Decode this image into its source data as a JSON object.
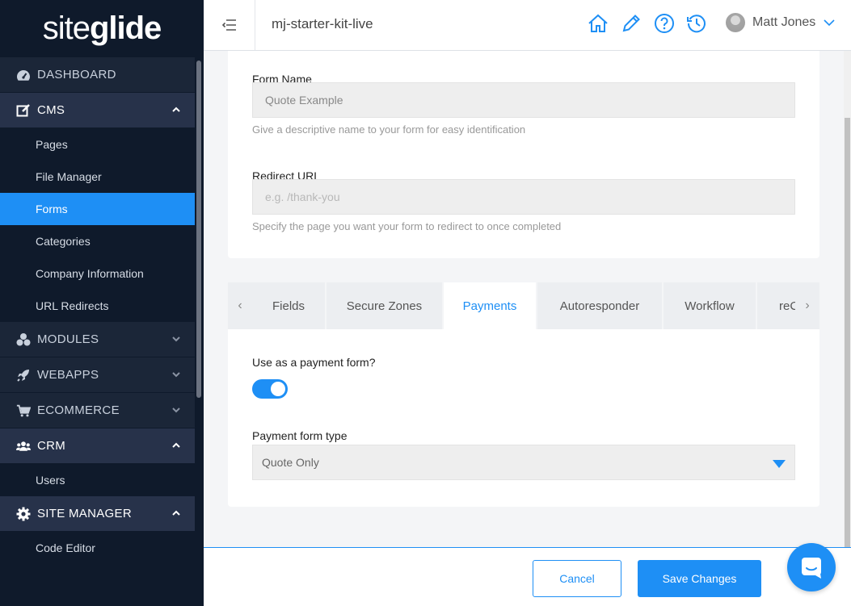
{
  "brand": {
    "logo_light": "site",
    "logo_bold": "glide"
  },
  "sidebar": {
    "sections": [
      {
        "label": "DASHBOARD",
        "icon": "dashboard-icon"
      },
      {
        "label": "CMS",
        "icon": "edit-icon",
        "expanded": true,
        "items": [
          "Pages",
          "File Manager",
          "Forms",
          "Categories",
          "Company Information",
          "URL Redirects"
        ],
        "active_item": "Forms"
      },
      {
        "label": "MODULES",
        "icon": "modules-icon"
      },
      {
        "label": "WEBAPPS",
        "icon": "rocket-icon"
      },
      {
        "label": "ECOMMERCE",
        "icon": "cart-icon"
      },
      {
        "label": "CRM",
        "icon": "users-icon",
        "expanded": true,
        "items": [
          "Users"
        ]
      },
      {
        "label": "SITE MANAGER",
        "icon": "gear-icon",
        "expanded": true,
        "items": [
          "Code Editor"
        ]
      }
    ]
  },
  "header": {
    "site_name": "mj-starter-kit-live",
    "user_name": "Matt Jones",
    "icons": [
      "home-icon",
      "pencil-icon",
      "help-icon",
      "history-icon"
    ]
  },
  "form": {
    "name_label": "Form Name",
    "name_value": "Quote Example",
    "name_help": "Give a descriptive name to your form for easy identification",
    "redirect_label": "Redirect URL",
    "redirect_placeholder": "e.g. /thank-you",
    "redirect_help": "Specify the page you want your form to redirect to once completed"
  },
  "tabs": {
    "items": [
      "Fields",
      "Secure Zones",
      "Payments",
      "Autoresponder",
      "Workflow",
      "reC"
    ],
    "active": "Payments",
    "prev_arrow": "‹",
    "next_arrow": "›"
  },
  "payments": {
    "use_label": "Use as a payment form?",
    "use_enabled": true,
    "type_label": "Payment form type",
    "type_value": "Quote Only"
  },
  "footer": {
    "cancel_label": "Cancel",
    "save_label": "Save Changes"
  },
  "colors": {
    "accent": "#1e8ff5",
    "sidebar_bg": "#0f1a2b",
    "sidebar_section_bg": "#1b2638"
  }
}
